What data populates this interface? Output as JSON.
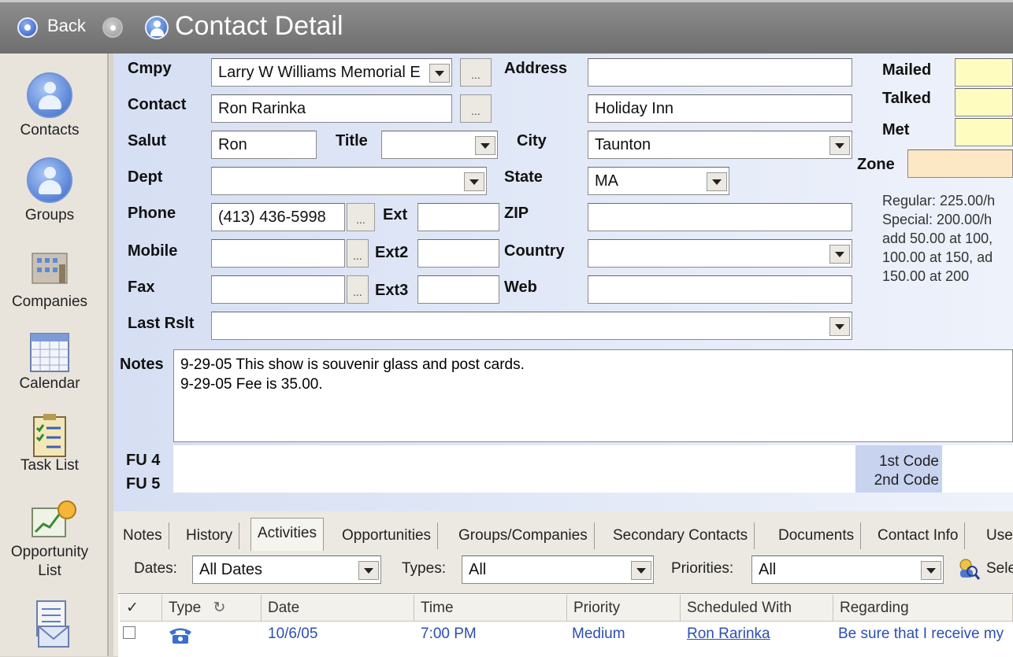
{
  "titlebar": {
    "back_label": "Back",
    "title": "Contact Detail"
  },
  "sidebar": {
    "items": [
      {
        "label": "Contacts",
        "icon": "contacts-icon"
      },
      {
        "label": "Groups",
        "icon": "groups-icon"
      },
      {
        "label": "Companies",
        "icon": "companies-icon"
      },
      {
        "label": "Calendar",
        "icon": "calendar-icon"
      },
      {
        "label": "Task List",
        "icon": "task-list-icon"
      },
      {
        "label": "Opportunity",
        "label2": "List",
        "icon": "opportunity-list-icon"
      },
      {
        "label": "",
        "icon": "email-icon"
      }
    ]
  },
  "form": {
    "labels": {
      "cmpy": "Cmpy",
      "contact": "Contact",
      "salut": "Salut",
      "title": "Title",
      "dept": "Dept",
      "phone": "Phone",
      "ext": "Ext",
      "mobile": "Mobile",
      "ext2": "Ext2",
      "fax": "Fax",
      "ext3": "Ext3",
      "last_rslt": "Last Rslt",
      "notes": "Notes",
      "fu4": "FU 4",
      "fu5": "FU 5",
      "address": "Address",
      "city": "City",
      "state": "State",
      "zip": "ZIP",
      "country": "Country",
      "web": "Web",
      "mailed": "Mailed",
      "talked": "Talked",
      "met": "Met",
      "zone": "Zone",
      "code1": "1st Code",
      "code2": "2nd Code"
    },
    "values": {
      "cmpy": "Larry W Williams Memorial E",
      "contact": "Ron Rarinka",
      "salut": "Ron",
      "title": "",
      "dept": "",
      "phone": "(413) 436-5998",
      "ext": "",
      "mobile": "",
      "ext2": "",
      "fax": "",
      "ext3": "",
      "last_rslt": "",
      "address": "",
      "address2": "Holiday Inn",
      "city": "Taunton",
      "state": "MA",
      "zip": "",
      "country": "",
      "web": ""
    },
    "ellipsis": "...",
    "notes_lines": [
      "9-29-05 This show is souvenir glass and post cards.",
      "9-29-05 Fee is 35.00."
    ],
    "rates": [
      "Regular: 225.00/h",
      "Special: 200.00/h",
      "add 50.00 at 100,",
      "100.00 at 150, ad",
      "150.00 at 200"
    ]
  },
  "tabs": [
    "Notes",
    "History",
    "Activities",
    "Opportunities",
    "Groups/Companies",
    "Secondary Contacts",
    "Documents",
    "Contact Info",
    "Use"
  ],
  "active_tab": "Activities",
  "filters": {
    "dates_label": "Dates:",
    "dates_value": "All Dates",
    "types_label": "Types:",
    "types_value": "All",
    "priorities_label": "Priorities:",
    "priorities_value": "All",
    "select_label": "Sele"
  },
  "grid": {
    "columns": [
      "Type",
      "Date",
      "Time",
      "Priority",
      "Scheduled With",
      "Regarding"
    ],
    "rows": [
      {
        "date": "10/6/05",
        "time": "7:00 PM",
        "priority": "Medium",
        "scheduled_with": "Ron Rarinka",
        "regarding": "Be sure that I receive my"
      }
    ]
  }
}
